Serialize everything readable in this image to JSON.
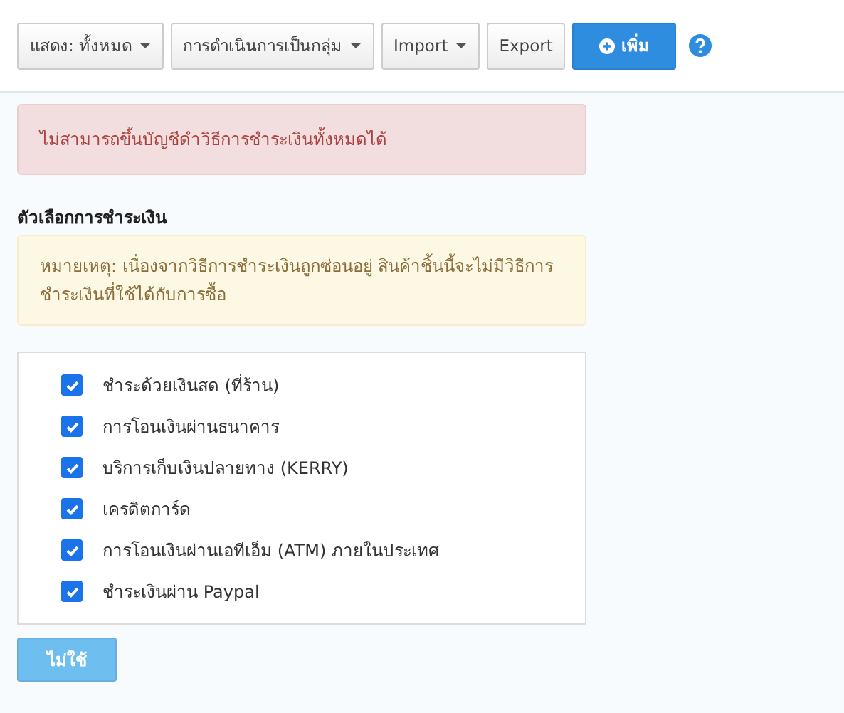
{
  "toolbar": {
    "buttons": [
      {
        "label": "แสดง: ทั้งหมด",
        "kind": "dropdown"
      },
      {
        "label": "การดำเนินการเป็นกลุ่ม",
        "kind": "dropdown"
      },
      {
        "label": "Import",
        "kind": "dropdown"
      },
      {
        "label": "Export",
        "kind": "plain"
      },
      {
        "label": "เพิ่ม",
        "kind": "primary"
      }
    ]
  },
  "error_alert": "ไม่สามารถขึ้นบัญชีดำวิธีการชำระเงินทั้งหมดได้",
  "payment_options": {
    "heading": "ตัวเลือกการชำระเงิน",
    "note": "หมายเหตุ: เนื่องจากวิธีการชำระเงินถูกซ่อนอยู่ สินค้าชิ้นนี้จะไม่มีวิธีการชำระเงินที่ใช้ได้กับการซื้อ",
    "methods": [
      {
        "label": "ชำระด้วยเงินสด (ที่ร้าน)",
        "checked": true
      },
      {
        "label": "การโอนเงินผ่านธนาคาร",
        "checked": true
      },
      {
        "label": "บริการเก็บเงินปลายทาง (KERRY)",
        "checked": true
      },
      {
        "label": "เครดิตการ์ด",
        "checked": true
      },
      {
        "label": "การโอนเงินผ่านเอทีเอ็ม (ATM) ภายในประเทศ",
        "checked": true
      },
      {
        "label": "ชำระเงินผ่าน Paypal",
        "checked": true
      }
    ]
  },
  "disable_button": {
    "label": "ไม่ใช้",
    "disabled": true
  }
}
